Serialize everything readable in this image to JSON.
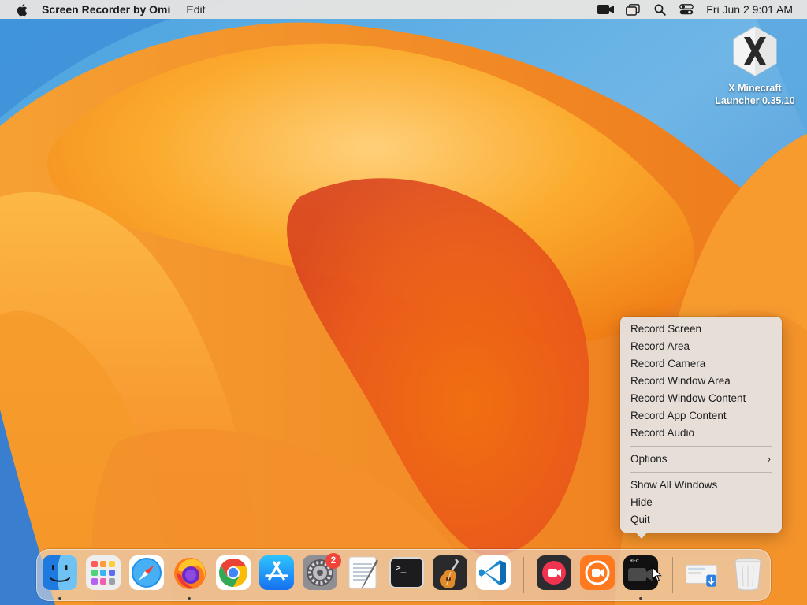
{
  "menubar": {
    "app_name": "Screen Recorder by Omi",
    "menus": [
      "Edit"
    ],
    "clock": "Fri Jun 2  9:01 AM",
    "status_icons": [
      "camera-recording-icon",
      "window-switcher-icon",
      "spotlight-search-icon",
      "control-center-icon"
    ]
  },
  "desktop": {
    "icons": [
      {
        "label_line1": "X Minecraft",
        "label_line2": "Launcher 0.35.10",
        "icon": "x-minecraft-launcher-icon"
      }
    ]
  },
  "context_menu": {
    "items": [
      "Record Screen",
      "Record Area",
      "Record Camera",
      "Record Window Area",
      "Record Window Content",
      "Record App Content",
      "Record Audio"
    ],
    "options_label": "Options",
    "options_chevron": "›",
    "window_items": [
      "Show All Windows",
      "Hide",
      "Quit"
    ]
  },
  "dock": {
    "apps": [
      {
        "name": "Finder",
        "icon": "finder-icon",
        "running": true
      },
      {
        "name": "Launchpad",
        "icon": "launchpad-icon",
        "running": false
      },
      {
        "name": "Safari",
        "icon": "safari-icon",
        "running": false
      },
      {
        "name": "Firefox",
        "icon": "firefox-icon",
        "running": true
      },
      {
        "name": "Google Chrome",
        "icon": "chrome-icon",
        "running": false
      },
      {
        "name": "App Store",
        "icon": "app-store-icon",
        "running": false
      },
      {
        "name": "System Preferences",
        "icon": "system-preferences-icon",
        "running": false,
        "badge": "2"
      },
      {
        "name": "TextEdit",
        "icon": "textedit-icon",
        "running": false
      },
      {
        "name": "Terminal",
        "icon": "terminal-icon",
        "running": false
      },
      {
        "name": "GarageBand",
        "icon": "garageband-icon",
        "running": false
      },
      {
        "name": "Visual Studio Code",
        "icon": "vscode-icon",
        "running": false
      },
      {
        "name": "Screen Recorder",
        "icon": "screen-recorder-red-icon",
        "running": false
      },
      {
        "name": "Omi Recorder",
        "icon": "omi-recorder-orange-icon",
        "running": false
      },
      {
        "name": "Screen Recorder by Omi",
        "icon": "screen-recorder-by-omi-icon",
        "running": true
      },
      {
        "name": "Downloads",
        "icon": "downloads-stack-icon",
        "running": false
      },
      {
        "name": "Trash",
        "icon": "trash-icon",
        "running": false
      }
    ],
    "terminal_prompt": ">_",
    "rec_label": "REC"
  },
  "colors": {
    "wallpaper_orange": "#f28c1c",
    "wallpaper_blue": "#3d8fd6",
    "badge_red": "#f0443a"
  }
}
